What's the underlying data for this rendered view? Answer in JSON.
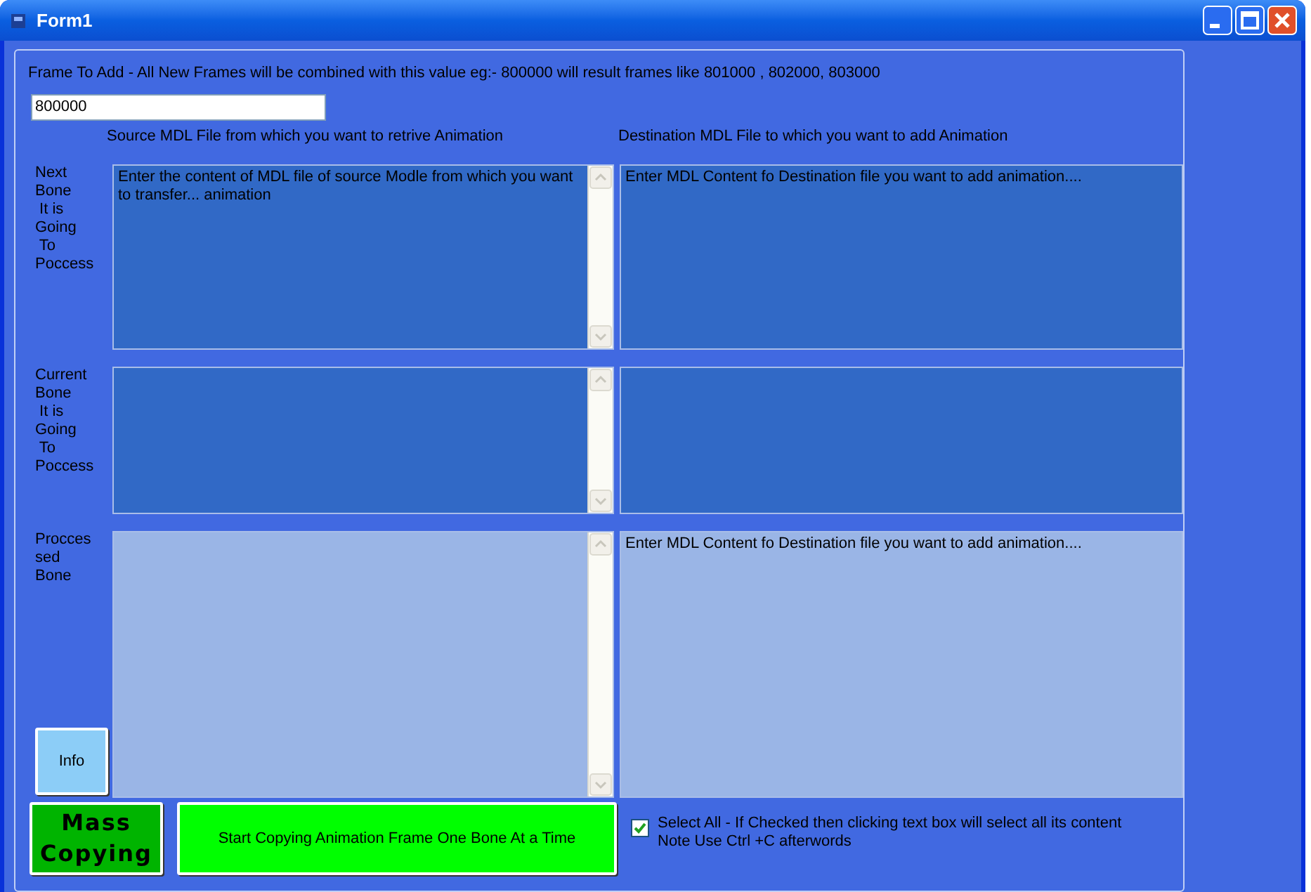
{
  "window": {
    "title": "Form1"
  },
  "frame_hint": "Frame To Add - All New Frames will be combined with this value eg:- 800000 will result frames like 801000  , 802000, 803000",
  "frame_value": "800000",
  "column_headings": [
    "Source MDL File from which you want to retrive Animation",
    "Destination MDL File to which you want to add Animation"
  ],
  "rows": [
    {
      "label": "Next\nBone\n It is\nGoing\n To\nPoccess",
      "kind": "input",
      "source": "Enter the content of MDL file of source Modle from which you want to transfer... animation",
      "destination": "Enter MDL Content fo Destination file you want to add animation...."
    },
    {
      "label": "Current\nBone\n It is\nGoing\n To\nPoccess",
      "kind": "input"
    },
    {
      "label": "Procces\nsed\nBone",
      "kind": "output",
      "destination": "Enter MDL Content fo Destination file you want to add animation....",
      "button": "Info"
    }
  ],
  "mass_button": "Mass\nCopying",
  "start_button": "Start Copying Animation Frame One Bone At a Time",
  "select_all": {
    "label": "Select All - If Checked then clicking text box will select all its content\nNote Use Ctrl +C afterwords",
    "checked": true
  }
}
